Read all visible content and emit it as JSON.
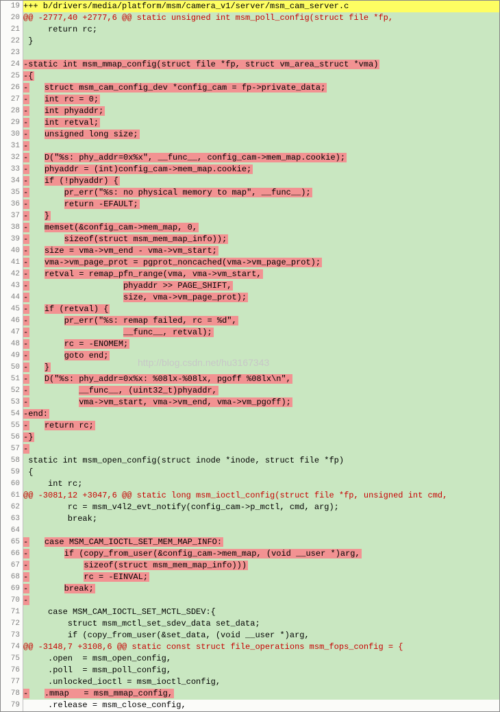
{
  "watermark": "http://blog.csdn.net/hu3167343",
  "lines": [
    {
      "n": 19,
      "bg": "bg-yellow",
      "segs": [
        {
          "t": "+++ b/drivers/media/platform/msm/camera_v1/server/msm_cam_server.c"
        }
      ]
    },
    {
      "n": 20,
      "bg": "bg-green",
      "segs": [
        {
          "t": "@@ -2777,40 +2777,6 @@ static unsigned int msm_poll_config(struct file *fp,",
          "cls": "fg-red"
        }
      ]
    },
    {
      "n": 21,
      "bg": "bg-green",
      "segs": [
        {
          "t": "     return rc;"
        }
      ]
    },
    {
      "n": 22,
      "bg": "bg-green",
      "segs": [
        {
          "t": " }"
        }
      ]
    },
    {
      "n": 23,
      "bg": "bg-green",
      "segs": [
        {
          "t": " "
        }
      ]
    },
    {
      "n": 24,
      "bg": "bg-green",
      "segs": [
        {
          "t": "-static int msm_mmap_config(struct file *fp, struct vm_area_struct *vma)",
          "hl": true
        }
      ]
    },
    {
      "n": 25,
      "bg": "bg-green",
      "segs": [
        {
          "t": "-{",
          "hl": true
        }
      ]
    },
    {
      "n": 26,
      "bg": "bg-green",
      "segs": [
        {
          "t": "-",
          "hl": true
        },
        {
          "t": "   "
        },
        {
          "t": "struct msm_cam_config_dev *config_cam = fp->private_data;",
          "hl": true
        }
      ]
    },
    {
      "n": 27,
      "bg": "bg-green",
      "segs": [
        {
          "t": "-",
          "hl": true
        },
        {
          "t": "   "
        },
        {
          "t": "int rc = 0;",
          "hl": true
        }
      ]
    },
    {
      "n": 28,
      "bg": "bg-green",
      "segs": [
        {
          "t": "-",
          "hl": true
        },
        {
          "t": "   "
        },
        {
          "t": "int phyaddr;",
          "hl": true
        }
      ]
    },
    {
      "n": 29,
      "bg": "bg-green",
      "segs": [
        {
          "t": "-",
          "hl": true
        },
        {
          "t": "   "
        },
        {
          "t": "int retval;",
          "hl": true
        }
      ]
    },
    {
      "n": 30,
      "bg": "bg-green",
      "segs": [
        {
          "t": "-",
          "hl": true
        },
        {
          "t": "   "
        },
        {
          "t": "unsigned long size;",
          "hl": true
        }
      ]
    },
    {
      "n": 31,
      "bg": "bg-green",
      "segs": [
        {
          "t": "-",
          "hl": true
        }
      ]
    },
    {
      "n": 32,
      "bg": "bg-green",
      "segs": [
        {
          "t": "-",
          "hl": true
        },
        {
          "t": "   "
        },
        {
          "t": "D(\"%s: phy_addr=0x%x\", __func__, config_cam->mem_map.cookie);",
          "hl": true
        }
      ]
    },
    {
      "n": 33,
      "bg": "bg-green",
      "segs": [
        {
          "t": "-",
          "hl": true
        },
        {
          "t": "   "
        },
        {
          "t": "phyaddr = (int)config_cam->mem_map.cookie;",
          "hl": true
        }
      ]
    },
    {
      "n": 34,
      "bg": "bg-green",
      "segs": [
        {
          "t": "-",
          "hl": true
        },
        {
          "t": "   "
        },
        {
          "t": "if (!phyaddr) {",
          "hl": true
        }
      ]
    },
    {
      "n": 35,
      "bg": "bg-green",
      "segs": [
        {
          "t": "-",
          "hl": true
        },
        {
          "t": "       "
        },
        {
          "t": "pr_err(\"%s: no physical memory to map\", __func__);",
          "hl": true
        }
      ]
    },
    {
      "n": 36,
      "bg": "bg-green",
      "segs": [
        {
          "t": "-",
          "hl": true
        },
        {
          "t": "       "
        },
        {
          "t": "return -EFAULT;",
          "hl": true
        }
      ]
    },
    {
      "n": 37,
      "bg": "bg-green",
      "segs": [
        {
          "t": "-",
          "hl": true
        },
        {
          "t": "   "
        },
        {
          "t": "}",
          "hl": true
        }
      ]
    },
    {
      "n": 38,
      "bg": "bg-green",
      "segs": [
        {
          "t": "-",
          "hl": true
        },
        {
          "t": "   "
        },
        {
          "t": "memset(&config_cam->mem_map, 0,",
          "hl": true
        }
      ]
    },
    {
      "n": 39,
      "bg": "bg-green",
      "segs": [
        {
          "t": "-",
          "hl": true
        },
        {
          "t": "       "
        },
        {
          "t": "sizeof(struct msm_mem_map_info));",
          "hl": true
        }
      ]
    },
    {
      "n": 40,
      "bg": "bg-green",
      "segs": [
        {
          "t": "-",
          "hl": true
        },
        {
          "t": "   "
        },
        {
          "t": "size = vma->vm_end - vma->vm_start;",
          "hl": true
        }
      ]
    },
    {
      "n": 41,
      "bg": "bg-green",
      "segs": [
        {
          "t": "-",
          "hl": true
        },
        {
          "t": "   "
        },
        {
          "t": "vma->vm_page_prot = pgprot_noncached(vma->vm_page_prot);",
          "hl": true
        }
      ]
    },
    {
      "n": 42,
      "bg": "bg-green",
      "segs": [
        {
          "t": "-",
          "hl": true
        },
        {
          "t": "   "
        },
        {
          "t": "retval = remap_pfn_range(vma, vma->vm_start,",
          "hl": true
        }
      ]
    },
    {
      "n": 43,
      "bg": "bg-green",
      "segs": [
        {
          "t": "-",
          "hl": true
        },
        {
          "t": "                   "
        },
        {
          "t": "phyaddr >> PAGE_SHIFT,",
          "hl": true
        }
      ]
    },
    {
      "n": 44,
      "bg": "bg-green",
      "segs": [
        {
          "t": "-",
          "hl": true
        },
        {
          "t": "                   "
        },
        {
          "t": "size, vma->vm_page_prot);",
          "hl": true
        }
      ]
    },
    {
      "n": 45,
      "bg": "bg-green",
      "segs": [
        {
          "t": "-",
          "hl": true
        },
        {
          "t": "   "
        },
        {
          "t": "if (retval) {",
          "hl": true
        }
      ]
    },
    {
      "n": 46,
      "bg": "bg-green",
      "segs": [
        {
          "t": "-",
          "hl": true
        },
        {
          "t": "       "
        },
        {
          "t": "pr_err(\"%s: remap failed, rc = %d\",",
          "hl": true
        }
      ]
    },
    {
      "n": 47,
      "bg": "bg-green",
      "segs": [
        {
          "t": "-",
          "hl": true
        },
        {
          "t": "                   "
        },
        {
          "t": "__func__, retval);",
          "hl": true
        }
      ]
    },
    {
      "n": 48,
      "bg": "bg-green",
      "segs": [
        {
          "t": "-",
          "hl": true
        },
        {
          "t": "       "
        },
        {
          "t": "rc = -ENOMEM;",
          "hl": true
        }
      ]
    },
    {
      "n": 49,
      "bg": "bg-green",
      "segs": [
        {
          "t": "-",
          "hl": true
        },
        {
          "t": "       "
        },
        {
          "t": "goto end;",
          "hl": true
        }
      ]
    },
    {
      "n": 50,
      "bg": "bg-green",
      "segs": [
        {
          "t": "-",
          "hl": true
        },
        {
          "t": "   "
        },
        {
          "t": "}",
          "hl": true
        }
      ]
    },
    {
      "n": 51,
      "bg": "bg-green",
      "segs": [
        {
          "t": "-",
          "hl": true
        },
        {
          "t": "   "
        },
        {
          "t": "D(\"%s: phy_addr=0x%x: %08lx-%08lx, pgoff %08lx\\n\",",
          "hl": true
        }
      ]
    },
    {
      "n": 52,
      "bg": "bg-green",
      "segs": [
        {
          "t": "-",
          "hl": true
        },
        {
          "t": "          "
        },
        {
          "t": "__func__, (uint32_t)phyaddr,",
          "hl": true
        }
      ]
    },
    {
      "n": 53,
      "bg": "bg-green",
      "segs": [
        {
          "t": "-",
          "hl": true
        },
        {
          "t": "          "
        },
        {
          "t": "vma->vm_start, vma->vm_end, vma->vm_pgoff);",
          "hl": true
        }
      ]
    },
    {
      "n": 54,
      "bg": "bg-green",
      "segs": [
        {
          "t": "-end:",
          "hl": true
        }
      ]
    },
    {
      "n": 55,
      "bg": "bg-green",
      "segs": [
        {
          "t": "-",
          "hl": true
        },
        {
          "t": "   "
        },
        {
          "t": "return rc;",
          "hl": true
        }
      ]
    },
    {
      "n": 56,
      "bg": "bg-green",
      "segs": [
        {
          "t": "-}",
          "hl": true
        }
      ]
    },
    {
      "n": 57,
      "bg": "bg-green",
      "segs": [
        {
          "t": "-",
          "hl": true
        }
      ]
    },
    {
      "n": 58,
      "bg": "bg-green",
      "segs": [
        {
          "t": " static int msm_open_config(struct inode *inode, struct file *fp)"
        }
      ]
    },
    {
      "n": 59,
      "bg": "bg-green",
      "segs": [
        {
          "t": " {"
        }
      ]
    },
    {
      "n": 60,
      "bg": "bg-green",
      "segs": [
        {
          "t": "     int rc;"
        }
      ]
    },
    {
      "n": 61,
      "bg": "bg-green",
      "segs": [
        {
          "t": "@@ -3081,12 +3047,6 @@ static long msm_ioctl_config(struct file *fp, unsigned int cmd,",
          "cls": "fg-red"
        }
      ]
    },
    {
      "n": 62,
      "bg": "bg-green",
      "segs": [
        {
          "t": "         rc = msm_v4l2_evt_notify(config_cam->p_mctl, cmd, arg);"
        }
      ]
    },
    {
      "n": 63,
      "bg": "bg-green",
      "segs": [
        {
          "t": "         break;"
        }
      ]
    },
    {
      "n": 64,
      "bg": "bg-green",
      "segs": [
        {
          "t": " "
        }
      ]
    },
    {
      "n": 65,
      "bg": "bg-green",
      "segs": [
        {
          "t": "-",
          "hl": true
        },
        {
          "t": "   "
        },
        {
          "t": "case MSM_CAM_IOCTL_SET_MEM_MAP_INFO:",
          "hl": true
        }
      ]
    },
    {
      "n": 66,
      "bg": "bg-green",
      "segs": [
        {
          "t": "-",
          "hl": true
        },
        {
          "t": "       "
        },
        {
          "t": "if (copy_from_user(&config_cam->mem_map, (void __user *)arg,",
          "hl": true
        }
      ]
    },
    {
      "n": 67,
      "bg": "bg-green",
      "segs": [
        {
          "t": "-",
          "hl": true
        },
        {
          "t": "           "
        },
        {
          "t": "sizeof(struct msm_mem_map_info)))",
          "hl": true
        }
      ]
    },
    {
      "n": 68,
      "bg": "bg-green",
      "segs": [
        {
          "t": "-",
          "hl": true
        },
        {
          "t": "           "
        },
        {
          "t": "rc = -EINVAL;",
          "hl": true
        }
      ]
    },
    {
      "n": 69,
      "bg": "bg-green",
      "segs": [
        {
          "t": "-",
          "hl": true
        },
        {
          "t": "       "
        },
        {
          "t": "break;",
          "hl": true
        }
      ]
    },
    {
      "n": 70,
      "bg": "bg-green",
      "segs": [
        {
          "t": "-",
          "hl": true
        }
      ]
    },
    {
      "n": 71,
      "bg": "bg-green",
      "segs": [
        {
          "t": "     case MSM_CAM_IOCTL_SET_MCTL_SDEV:{"
        }
      ]
    },
    {
      "n": 72,
      "bg": "bg-green",
      "segs": [
        {
          "t": "         struct msm_mctl_set_sdev_data set_data;"
        }
      ]
    },
    {
      "n": 73,
      "bg": "bg-green",
      "segs": [
        {
          "t": "         if (copy_from_user(&set_data, (void __user *)arg,"
        }
      ]
    },
    {
      "n": 74,
      "bg": "bg-green",
      "segs": [
        {
          "t": "@@ -3148,7 +3108,6 @@ static const struct file_operations msm_fops_config = {",
          "cls": "fg-red"
        }
      ]
    },
    {
      "n": 75,
      "bg": "bg-green",
      "segs": [
        {
          "t": "     .open  = msm_open_config,"
        }
      ]
    },
    {
      "n": 76,
      "bg": "bg-green",
      "segs": [
        {
          "t": "     .poll  = msm_poll_config,"
        }
      ]
    },
    {
      "n": 77,
      "bg": "bg-green",
      "segs": [
        {
          "t": "     .unlocked_ioctl = msm_ioctl_config,"
        }
      ]
    },
    {
      "n": 78,
      "bg": "bg-green",
      "segs": [
        {
          "t": "-",
          "hl": true
        },
        {
          "t": "   "
        },
        {
          "t": ".mmap   = msm_mmap_config,",
          "hl": true
        }
      ]
    },
    {
      "n": 79,
      "bg": "bg-white",
      "segs": [
        {
          "t": "     .release = msm_close_config,"
        }
      ]
    }
  ]
}
